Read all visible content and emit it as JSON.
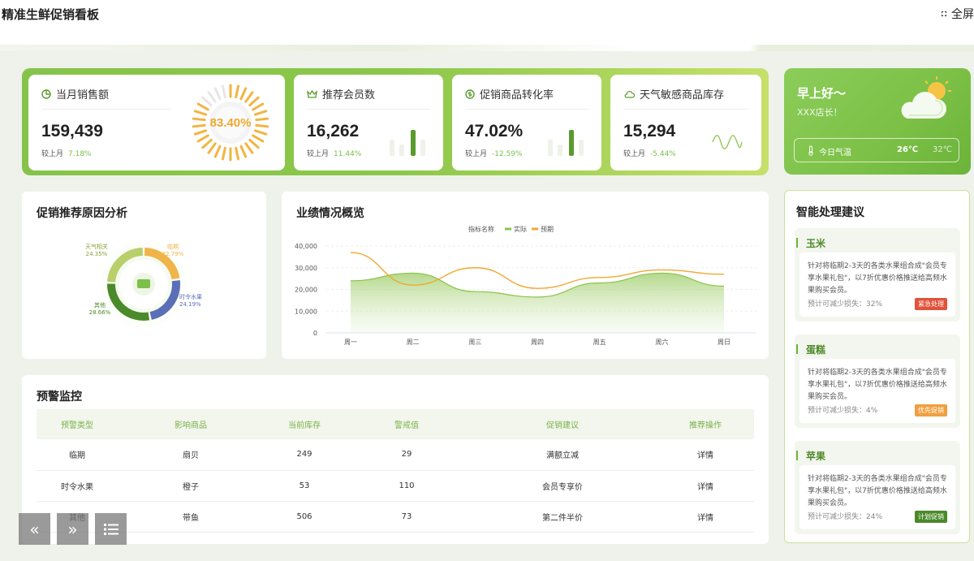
{
  "header": {
    "title": "精准生鲜促销看板",
    "fullscreen_label": "全屏"
  },
  "kpis": [
    {
      "title": "当月销售额",
      "value": "159,439",
      "compare_label": "较上月",
      "compare_value": "7.18%",
      "gauge_value": "83.40%",
      "gauge_fraction": 0.834,
      "icon": "pie-chart-icon"
    },
    {
      "title": "推荐会员数",
      "value": "16,262",
      "compare_label": "较上月",
      "compare_value": "11.44%",
      "icon": "crown-icon"
    },
    {
      "title": "促销商品转化率",
      "value": "47.02%",
      "compare_label": "较上月",
      "compare_value": "-12.59%",
      "icon": "dollar-cycle-icon"
    },
    {
      "title": "天气敏感商品库存",
      "value": "15,294",
      "compare_label": "较上月",
      "compare_value": "-5.44%",
      "icon": "cloud-icon"
    }
  ],
  "weather": {
    "greeting": "早上好～",
    "user": "XXX店长！",
    "label": "今日气温",
    "temp_low": "26℃",
    "temp_high": "32℃",
    "icon": "sun-cloud-icon"
  },
  "reason": {
    "title": "促销推荐原因分析",
    "slices": [
      {
        "name": "临期",
        "pct": "22.79%",
        "value": 22.79,
        "color": "#f0b44a"
      },
      {
        "name": "时令水果",
        "pct": "24.19%",
        "value": 24.19,
        "color": "#5b6fb8"
      },
      {
        "name": "其他",
        "pct": "28.66%",
        "value": 28.66,
        "color": "#4a8a2a"
      },
      {
        "name": "天气相关",
        "pct": "24.35%",
        "value": 24.35,
        "color": "#b8cf6a"
      }
    ]
  },
  "perf": {
    "title": "业绩情况概览",
    "legend_title": "指标名称",
    "series_names": [
      "实际",
      "预期"
    ]
  },
  "chart_data": {
    "type": "line",
    "x": [
      "周一",
      "周二",
      "周三",
      "周四",
      "周五",
      "周六",
      "周日"
    ],
    "ylim": [
      0,
      40000
    ],
    "yticks": [
      "0",
      "10,000",
      "20,000",
      "30,000",
      "40,000"
    ],
    "series": [
      {
        "name": "实际",
        "values": [
          24000,
          27500,
          19000,
          16500,
          23000,
          27500,
          21500
        ],
        "color": "#8bc34a"
      },
      {
        "name": "预期",
        "values": [
          37000,
          22000,
          30000,
          20500,
          25500,
          29000,
          27000
        ],
        "color": "#f0a830"
      }
    ]
  },
  "warning": {
    "title": "预警监控",
    "columns": [
      "预警类型",
      "影响商品",
      "当前库存",
      "警戒值",
      "促销建议",
      "推荐操作"
    ],
    "rows": [
      [
        "临期",
        "扇贝",
        "249",
        "29",
        "满额立减",
        "详情"
      ],
      [
        "时令水果",
        "橙子",
        "53",
        "110",
        "会员专享价",
        "详情"
      ],
      [
        "其他",
        "带鱼",
        "506",
        "73",
        "第二件半价",
        "详情"
      ]
    ]
  },
  "suggest": {
    "title": "智能处理建议",
    "items": [
      {
        "name": "玉米",
        "text": "针对将临期2-3天的各类水果组合成\"会员专享水果礼包\"，以7折优惠价格推送给高频水果购买会员。",
        "est": "预计可减少损失：32%",
        "tag": "紧急处理",
        "tag_color": "#e0523a"
      },
      {
        "name": "蛋糕",
        "text": "针对将临期2-3天的各类水果组合成\"会员专享水果礼包\"，以7折优惠价格推送给高频水果购买会员。",
        "est": "预计可减少损失：4%",
        "tag": "优先促销",
        "tag_color": "#f0a040"
      },
      {
        "name": "苹果",
        "text": "针对将临期2-3天的各类水果组合成\"会员专享水果礼包\"，以7折优惠价格推送给高频水果购买会员。",
        "est": "预计可减少损失：24%",
        "tag": "计划促销",
        "tag_color": "#4a8a2a"
      }
    ]
  },
  "nav": {
    "prev_icon": "double-chevron-left-icon",
    "next_icon": "double-chevron-right-icon",
    "menu_icon": "list-icon"
  }
}
